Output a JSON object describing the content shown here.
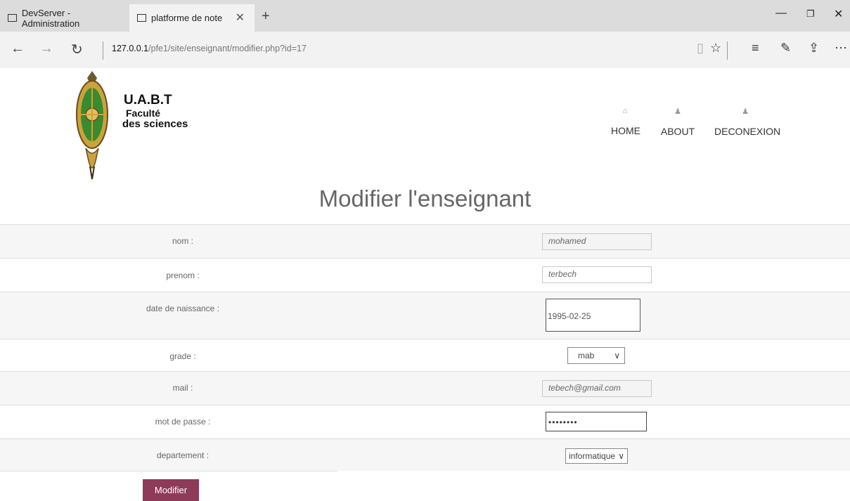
{
  "browser": {
    "tabs": [
      {
        "label": "DevServer - Administration"
      },
      {
        "label": "platforme de note"
      }
    ],
    "url_host": "127.0.0.1",
    "url_path": "/pfe1/site/enseignant/modifier.php?id=17"
  },
  "brand": {
    "line1": "U.A.B.T",
    "line2": "Faculté",
    "line3": "des sciences"
  },
  "menu": [
    {
      "label": "HOME",
      "icon": "home-icon"
    },
    {
      "label": "ABOUT",
      "icon": "user-icon"
    },
    {
      "label": "DECONEXION",
      "icon": "user-icon"
    }
  ],
  "page": {
    "title": "Modifier l'enseignant"
  },
  "form": {
    "nom": {
      "label": "nom :",
      "value": "mohamed"
    },
    "prenom": {
      "label": "prenom :",
      "value": "terbech"
    },
    "date": {
      "label": "date de naissance :",
      "value": "1995-02-25"
    },
    "grade": {
      "label": "grade :",
      "value": "mab"
    },
    "mail": {
      "label": "mail :",
      "value": "tebech@gmail.com"
    },
    "password": {
      "label": "mot de passe :",
      "value": "••••••••"
    },
    "departement": {
      "label": "departement :",
      "value": "informatique"
    },
    "submit_label": "Modifier"
  },
  "colors": {
    "accent": "#8e3a59"
  }
}
